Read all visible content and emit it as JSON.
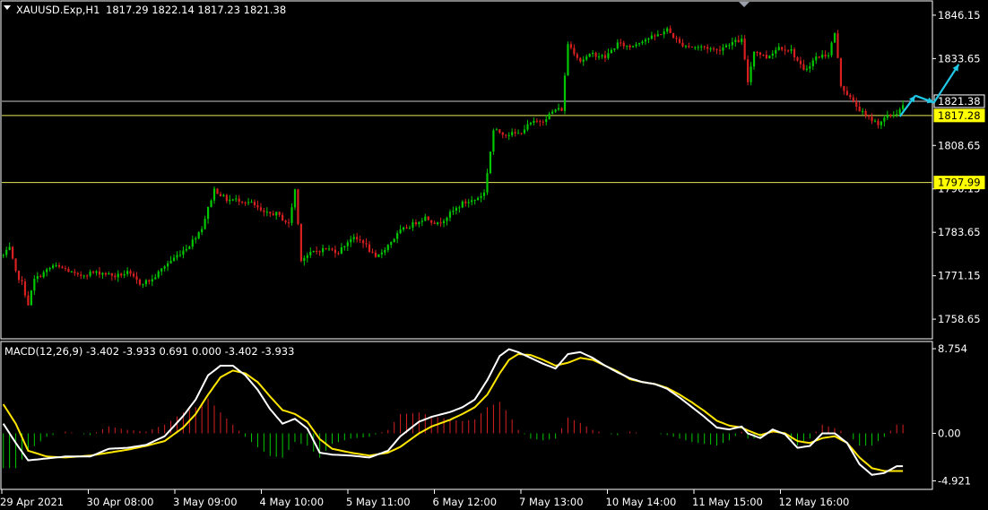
{
  "header": {
    "symbol": "XAUUSD.Exp,H1",
    "ohlc": "1817.29 1822.14 1817.23 1821.38"
  },
  "colors": {
    "background": "#000000",
    "axis": "#ffffff",
    "bull": "#00c800",
    "bear": "#d82020",
    "hline": "#e8e85a",
    "price_line": "#c8c8c8",
    "macd_line": "#ffffff",
    "signal_line": "#ffe600",
    "arrow": "#20c8e6"
  },
  "chart_data": [
    {
      "type": "candlestick",
      "title": "XAUUSD.Exp,H1",
      "ylim": [
        1753.0,
        1850.0
      ],
      "y_ticks": [
        "1846.15",
        "1833.65",
        "1821.15",
        "1808.65",
        "1796.15",
        "1783.65",
        "1771.15",
        "1758.65"
      ],
      "horizontal_lines": [
        {
          "value": 1821.38,
          "label": "1821.38",
          "style": "current-price"
        },
        {
          "value": 1817.28,
          "label": "1817.28",
          "style": "highlight"
        },
        {
          "value": 1797.99,
          "label": "1797.99",
          "style": "highlight"
        }
      ],
      "x_ticks": [
        "29 Apr 2021",
        "30 Apr 08:00",
        "3 May 09:00",
        "4 May 10:00",
        "5 May 11:00",
        "6 May 12:00",
        "7 May 13:00",
        "10 May 14:00",
        "11 May 15:00",
        "12 May 16:00"
      ],
      "close_path": [
        [
          0,
          1777
        ],
        [
          2,
          1779
        ],
        [
          4,
          1772
        ],
        [
          6,
          1769
        ],
        [
          8,
          1763
        ],
        [
          10,
          1770
        ],
        [
          13,
          1772
        ],
        [
          16,
          1774
        ],
        [
          20,
          1773
        ],
        [
          24,
          1771
        ],
        [
          28,
          1772
        ],
        [
          32,
          1772
        ],
        [
          36,
          1771
        ],
        [
          40,
          1772
        ],
        [
          44,
          1769
        ],
        [
          48,
          1770
        ],
        [
          52,
          1774
        ],
        [
          56,
          1777
        ],
        [
          60,
          1780
        ],
        [
          64,
          1785
        ],
        [
          68,
          1796
        ],
        [
          72,
          1793
        ],
        [
          76,
          1793
        ],
        [
          80,
          1792
        ],
        [
          84,
          1789
        ],
        [
          88,
          1789
        ],
        [
          92,
          1786
        ],
        [
          94,
          1796
        ],
        [
          96,
          1776
        ],
        [
          100,
          1778
        ],
        [
          104,
          1779
        ],
        [
          108,
          1778
        ],
        [
          112,
          1782
        ],
        [
          116,
          1781
        ],
        [
          120,
          1776
        ],
        [
          124,
          1780
        ],
        [
          128,
          1784
        ],
        [
          132,
          1786
        ],
        [
          136,
          1788
        ],
        [
          140,
          1786
        ],
        [
          144,
          1789
        ],
        [
          148,
          1792
        ],
        [
          152,
          1793
        ],
        [
          155,
          1795
        ],
        [
          158,
          1813
        ],
        [
          162,
          1812
        ],
        [
          166,
          1812
        ],
        [
          170,
          1815
        ],
        [
          174,
          1816
        ],
        [
          178,
          1819
        ],
        [
          180,
          1819
        ],
        [
          182,
          1838
        ],
        [
          186,
          1833
        ],
        [
          190,
          1835
        ],
        [
          194,
          1834
        ],
        [
          198,
          1838
        ],
        [
          202,
          1837
        ],
        [
          206,
          1839
        ],
        [
          210,
          1840
        ],
        [
          214,
          1842
        ],
        [
          218,
          1838
        ],
        [
          222,
          1837
        ],
        [
          226,
          1837
        ],
        [
          230,
          1836
        ],
        [
          234,
          1838
        ],
        [
          238,
          1839
        ],
        [
          240,
          1827
        ],
        [
          242,
          1836
        ],
        [
          246,
          1834
        ],
        [
          250,
          1837
        ],
        [
          254,
          1836
        ],
        [
          258,
          1830
        ],
        [
          262,
          1834
        ],
        [
          266,
          1835
        ],
        [
          268,
          1841
        ],
        [
          270,
          1826
        ],
        [
          274,
          1821
        ],
        [
          278,
          1817
        ],
        [
          282,
          1815
        ],
        [
          285,
          1817
        ],
        [
          288,
          1818
        ],
        [
          290,
          1820
        ]
      ],
      "projection_arrows": [
        [
          [
            289,
            1817
          ],
          [
            294,
            1823
          ]
        ],
        [
          [
            294,
            1823
          ],
          [
            300,
            1821
          ]
        ],
        [
          [
            300,
            1821
          ],
          [
            308,
            1832
          ]
        ]
      ]
    },
    {
      "type": "macd",
      "title": "MACD(12,26,9) -3.402 -3.933 0.691 0.000 -3.402 -3.933",
      "params": [
        12,
        26,
        9
      ],
      "ylim": [
        -5.8,
        9.5
      ],
      "y_ticks": [
        "8.754",
        "0.00",
        "-4.921"
      ],
      "macd_line": [
        [
          0,
          1.0
        ],
        [
          4,
          -1.0
        ],
        [
          8,
          -2.8
        ],
        [
          14,
          -2.6
        ],
        [
          20,
          -2.4
        ],
        [
          28,
          -2.4
        ],
        [
          34,
          -1.6
        ],
        [
          40,
          -1.5
        ],
        [
          46,
          -1.2
        ],
        [
          52,
          -0.3
        ],
        [
          58,
          1.8
        ],
        [
          62,
          3.5
        ],
        [
          66,
          6.0
        ],
        [
          70,
          7.0
        ],
        [
          74,
          7.0
        ],
        [
          78,
          6.0
        ],
        [
          82,
          4.5
        ],
        [
          86,
          2.5
        ],
        [
          90,
          1.0
        ],
        [
          94,
          1.5
        ],
        [
          98,
          0.5
        ],
        [
          102,
          -2.0
        ],
        [
          106,
          -2.2
        ],
        [
          112,
          -2.3
        ],
        [
          118,
          -2.5
        ],
        [
          124,
          -1.8
        ],
        [
          128,
          -0.3
        ],
        [
          134,
          1.2
        ],
        [
          138,
          1.7
        ],
        [
          144,
          2.2
        ],
        [
          148,
          2.7
        ],
        [
          152,
          3.5
        ],
        [
          156,
          5.5
        ],
        [
          160,
          8.0
        ],
        [
          163,
          8.7
        ],
        [
          166,
          8.4
        ],
        [
          170,
          7.8
        ],
        [
          174,
          7.2
        ],
        [
          178,
          6.7
        ],
        [
          182,
          8.2
        ],
        [
          186,
          8.4
        ],
        [
          190,
          7.8
        ],
        [
          194,
          7.0
        ],
        [
          198,
          6.3
        ],
        [
          202,
          5.7
        ],
        [
          206,
          5.3
        ],
        [
          210,
          5.1
        ],
        [
          214,
          4.6
        ],
        [
          218,
          3.7
        ],
        [
          222,
          2.7
        ],
        [
          226,
          1.7
        ],
        [
          230,
          0.6
        ],
        [
          234,
          0.4
        ],
        [
          238,
          0.7
        ],
        [
          240,
          0.0
        ],
        [
          244,
          -0.5
        ],
        [
          248,
          0.4
        ],
        [
          252,
          -0.1
        ],
        [
          256,
          -1.5
        ],
        [
          260,
          -1.3
        ],
        [
          264,
          0.0
        ],
        [
          268,
          0.0
        ],
        [
          272,
          -1.0
        ],
        [
          276,
          -3.2
        ],
        [
          280,
          -4.3
        ],
        [
          284,
          -4.1
        ],
        [
          288,
          -3.4
        ]
      ],
      "signal_line": [
        [
          0,
          3.0
        ],
        [
          4,
          1.0
        ],
        [
          8,
          -1.8
        ],
        [
          14,
          -2.4
        ],
        [
          20,
          -2.5
        ],
        [
          28,
          -2.3
        ],
        [
          34,
          -2.0
        ],
        [
          40,
          -1.7
        ],
        [
          46,
          -1.3
        ],
        [
          52,
          -0.8
        ],
        [
          58,
          0.6
        ],
        [
          62,
          2.0
        ],
        [
          66,
          4.0
        ],
        [
          70,
          5.8
        ],
        [
          74,
          6.5
        ],
        [
          78,
          6.2
        ],
        [
          82,
          5.3
        ],
        [
          86,
          3.8
        ],
        [
          90,
          2.4
        ],
        [
          94,
          2.0
        ],
        [
          98,
          1.2
        ],
        [
          102,
          -0.6
        ],
        [
          106,
          -1.6
        ],
        [
          112,
          -2.0
        ],
        [
          118,
          -2.3
        ],
        [
          124,
          -2.0
        ],
        [
          128,
          -1.4
        ],
        [
          134,
          0.0
        ],
        [
          138,
          0.7
        ],
        [
          144,
          1.4
        ],
        [
          148,
          2.0
        ],
        [
          152,
          2.7
        ],
        [
          156,
          4.0
        ],
        [
          160,
          6.2
        ],
        [
          163,
          7.6
        ],
        [
          166,
          8.2
        ],
        [
          170,
          8.1
        ],
        [
          174,
          7.6
        ],
        [
          178,
          7.0
        ],
        [
          182,
          7.3
        ],
        [
          186,
          7.8
        ],
        [
          190,
          7.6
        ],
        [
          194,
          7.0
        ],
        [
          198,
          6.4
        ],
        [
          202,
          5.6
        ],
        [
          206,
          5.3
        ],
        [
          210,
          5.1
        ],
        [
          214,
          4.7
        ],
        [
          218,
          4.0
        ],
        [
          222,
          3.2
        ],
        [
          226,
          2.3
        ],
        [
          230,
          1.3
        ],
        [
          234,
          0.8
        ],
        [
          238,
          0.6
        ],
        [
          240,
          0.3
        ],
        [
          244,
          -0.2
        ],
        [
          248,
          0.2
        ],
        [
          252,
          0.0
        ],
        [
          256,
          -0.8
        ],
        [
          260,
          -1.0
        ],
        [
          264,
          -0.5
        ],
        [
          268,
          -0.3
        ],
        [
          272,
          -1.0
        ],
        [
          276,
          -2.5
        ],
        [
          280,
          -3.6
        ],
        [
          284,
          -3.9
        ],
        [
          288,
          -3.9
        ]
      ]
    }
  ]
}
